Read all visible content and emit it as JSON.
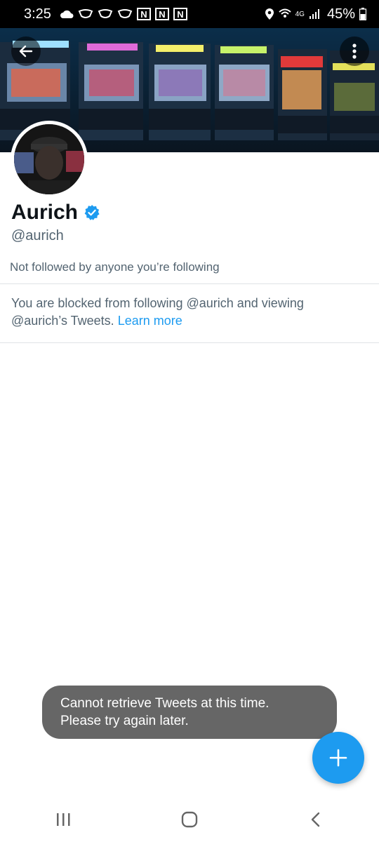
{
  "status_bar": {
    "time": "3:25",
    "n_badges": [
      "N",
      "N",
      "N"
    ],
    "network": "4G",
    "battery": "45%"
  },
  "icons": {
    "back": "arrow-left-icon",
    "more": "more-vertical-icon",
    "verified": "verified-badge-icon",
    "compose": "plus-icon"
  },
  "profile": {
    "display_name": "Aurich",
    "handle": "@aurich",
    "followers_note": "Not followed by anyone you’re following"
  },
  "blocked": {
    "message": "You are blocked from following @aurich and viewing @aurich’s Tweets. ",
    "link": "Learn more"
  },
  "toast": {
    "line1": "Cannot retrieve Tweets at this time.",
    "line2": "Please try again later."
  },
  "colors": {
    "accent": "#1d9bf0",
    "secondary_text": "#536471",
    "toast_bg": "#666666"
  }
}
